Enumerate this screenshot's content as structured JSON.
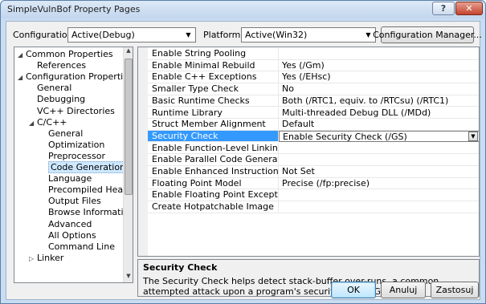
{
  "window": {
    "title": "SimpleVulnBof Property Pages",
    "help_button": "?",
    "close_button": "✕"
  },
  "top": {
    "configuration_label": "Configuration:",
    "configuration_value": "Active(Debug)",
    "platform_label": "Platform:",
    "platform_value": "Active(Win32)",
    "config_manager_button": "Configuration Manager..."
  },
  "tree": {
    "items": [
      {
        "label": "Common Properties",
        "twisty": "◢",
        "level": 0
      },
      {
        "label": "References",
        "twisty": "",
        "level": 1
      },
      {
        "label": "Configuration Properties",
        "twisty": "◢",
        "level": 0
      },
      {
        "label": "General",
        "twisty": "",
        "level": 1
      },
      {
        "label": "Debugging",
        "twisty": "",
        "level": 1
      },
      {
        "label": "VC++ Directories",
        "twisty": "",
        "level": 1
      },
      {
        "label": "C/C++",
        "twisty": "◢",
        "level": 1
      },
      {
        "label": "General",
        "twisty": "",
        "level": 2
      },
      {
        "label": "Optimization",
        "twisty": "",
        "level": 2
      },
      {
        "label": "Preprocessor",
        "twisty": "",
        "level": 2
      },
      {
        "label": "Code Generation",
        "twisty": "",
        "level": 2
      },
      {
        "label": "Language",
        "twisty": "",
        "level": 2
      },
      {
        "label": "Precompiled Heade",
        "twisty": "",
        "level": 2
      },
      {
        "label": "Output Files",
        "twisty": "",
        "level": 2
      },
      {
        "label": "Browse Information",
        "twisty": "",
        "level": 2
      },
      {
        "label": "Advanced",
        "twisty": "",
        "level": 2
      },
      {
        "label": "All Options",
        "twisty": "",
        "level": 2
      },
      {
        "label": "Command Line",
        "twisty": "",
        "level": 2
      },
      {
        "label": "Linker",
        "twisty": "▷",
        "level": 1
      }
    ],
    "selected_index": 10
  },
  "grid": {
    "rows": [
      {
        "name": "Enable String Pooling",
        "value": ""
      },
      {
        "name": "Enable Minimal Rebuild",
        "value": "Yes (/Gm)"
      },
      {
        "name": "Enable C++ Exceptions",
        "value": "Yes (/EHsc)"
      },
      {
        "name": "Smaller Type Check",
        "value": "No"
      },
      {
        "name": "Basic Runtime Checks",
        "value": "Both (/RTC1, equiv. to /RTCsu) (/RTC1)"
      },
      {
        "name": "Runtime Library",
        "value": "Multi-threaded Debug DLL (/MDd)"
      },
      {
        "name": "Struct Member Alignment",
        "value": "Default"
      },
      {
        "name": "Security Check",
        "value": "Enable Security Check (/GS)"
      },
      {
        "name": "Enable Function-Level Linking",
        "value": ""
      },
      {
        "name": "Enable Parallel Code Generation",
        "value": ""
      },
      {
        "name": "Enable Enhanced Instruction Set",
        "value": "Not Set"
      },
      {
        "name": "Floating Point Model",
        "value": "Precise (/fp:precise)"
      },
      {
        "name": "Enable Floating Point Exceptions",
        "value": ""
      },
      {
        "name": "Create Hotpatchable Image",
        "value": ""
      }
    ],
    "selected_index": 7
  },
  "description": {
    "title": "Security Check",
    "text": "The Security Check helps detect stack-buffer over-runs, a common attempted attack upon a program's security. (/GS-, /GS)"
  },
  "buttons": {
    "ok": "OK",
    "cancel": "Anuluj",
    "apply": "Zastosuj"
  },
  "colors": {
    "selection": "#3399ff",
    "window_frame": "#c9dcf1"
  }
}
